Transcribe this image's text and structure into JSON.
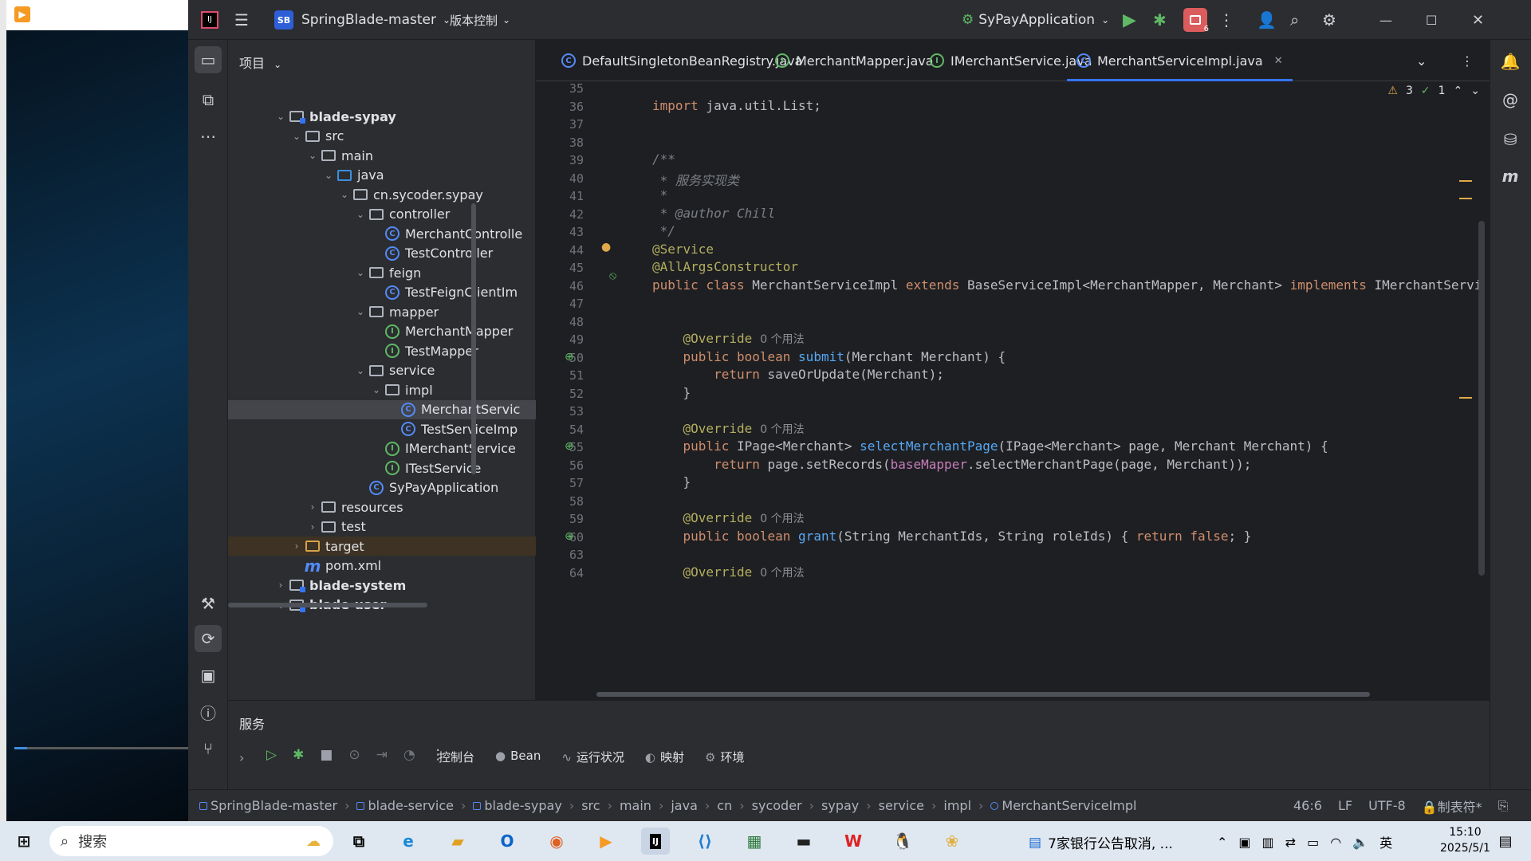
{
  "titlebar": {
    "project_badge": "SB",
    "project": "SpringBlade-master",
    "vcs": "版本控制",
    "run_config": "SyPayApplication",
    "notif_count": "6"
  },
  "project_panel": {
    "title": "项目"
  },
  "tree": [
    {
      "label": "blade-sypay",
      "icon": "module-folder-icon",
      "arrow": "⌄",
      "bold": true
    },
    {
      "label": "src",
      "icon": "folder-icon",
      "arrow": "⌄"
    },
    {
      "label": "main",
      "icon": "folder-icon",
      "arrow": "⌄"
    },
    {
      "label": "java",
      "icon": "source-folder-icon",
      "arrow": "⌄"
    },
    {
      "label": "cn.sycoder.sypay",
      "icon": "package-icon",
      "arrow": "⌄"
    },
    {
      "label": "controller",
      "icon": "package-icon",
      "arrow": "⌄"
    },
    {
      "label": "MerchantControlle",
      "icon": "class-icon",
      "arrow": ""
    },
    {
      "label": "TestController",
      "icon": "class-icon",
      "arrow": ""
    },
    {
      "label": "feign",
      "icon": "package-icon",
      "arrow": "⌄"
    },
    {
      "label": "TestFeignClientIm",
      "icon": "class-icon",
      "arrow": ""
    },
    {
      "label": "mapper",
      "icon": "package-icon",
      "arrow": "⌄"
    },
    {
      "label": "MerchantMapper",
      "icon": "interface-icon",
      "arrow": ""
    },
    {
      "label": "TestMapper",
      "icon": "interface-icon",
      "arrow": ""
    },
    {
      "label": "service",
      "icon": "package-icon",
      "arrow": "⌄"
    },
    {
      "label": "impl",
      "icon": "package-icon",
      "arrow": "⌄"
    },
    {
      "label": "MerchantServic",
      "icon": "class-icon",
      "arrow": "",
      "selected": true
    },
    {
      "label": "TestServiceImp",
      "icon": "class-icon",
      "arrow": ""
    },
    {
      "label": "IMerchantService",
      "icon": "interface-icon",
      "arrow": ""
    },
    {
      "label": "ITestService",
      "icon": "interface-icon",
      "arrow": ""
    },
    {
      "label": "SyPayApplication",
      "icon": "spring-app-icon",
      "arrow": ""
    },
    {
      "label": "resources",
      "icon": "folder-icon",
      "arrow": "›"
    },
    {
      "label": "test",
      "icon": "folder-icon",
      "arrow": "›"
    },
    {
      "label": "target",
      "icon": "target-folder-icon",
      "arrow": "›",
      "excluded": true
    },
    {
      "label": "pom.xml",
      "icon": "maven-icon",
      "arrow": ""
    },
    {
      "label": "blade-system",
      "icon": "module-folder-icon",
      "arrow": "›",
      "bold": true
    },
    {
      "label": "blade-user",
      "icon": "module-folder-icon",
      "arrow": "⌄",
      "bold": true
    }
  ],
  "tabs": [
    {
      "label": "DefaultSingletonBeanRegistry.java",
      "type": "class"
    },
    {
      "label": "MerchantMapper.java",
      "type": "interface"
    },
    {
      "label": "IMerchantService.java",
      "type": "interface"
    },
    {
      "label": "MerchantServiceImpl.java",
      "type": "class",
      "active": true
    }
  ],
  "inspections": {
    "warnings": "3",
    "ok": "1"
  },
  "code": [
    {
      "n": "35",
      "parts": []
    },
    {
      "n": "36",
      "parts": [
        {
          "t": "import",
          "c": "kw"
        },
        {
          "t": " java.util.List;"
        }
      ]
    },
    {
      "n": "37",
      "parts": []
    },
    {
      "n": "38",
      "parts": []
    },
    {
      "n": "39",
      "parts": [
        {
          "t": "/**",
          "c": "cm"
        }
      ]
    },
    {
      "n": "40",
      "parts": [
        {
          "t": " * 服务实现类",
          "c": "cm"
        }
      ]
    },
    {
      "n": "41",
      "parts": [
        {
          "t": " *",
          "c": "cm"
        }
      ]
    },
    {
      "n": "42",
      "parts": [
        {
          "t": " * @author Chill",
          "c": "cm"
        }
      ]
    },
    {
      "n": "43",
      "parts": [
        {
          "t": " */",
          "c": "cm"
        }
      ]
    },
    {
      "n": "44",
      "parts": [
        {
          "t": "@Service",
          "c": "an"
        }
      ]
    },
    {
      "n": "45",
      "parts": [
        {
          "t": "@AllArgsConstructor",
          "c": "an"
        }
      ]
    },
    {
      "n": "46",
      "parts": [
        {
          "t": "public",
          "c": "kw"
        },
        {
          "t": " "
        },
        {
          "t": "class",
          "c": "kw"
        },
        {
          "t": " MerchantServiceImpl "
        },
        {
          "t": "extends",
          "c": "kw"
        },
        {
          "t": " BaseServiceImpl<MerchantMapper, Merchant> "
        },
        {
          "t": "implements",
          "c": "kw"
        },
        {
          "t": " IMerchantServi"
        }
      ]
    },
    {
      "n": "47",
      "parts": []
    },
    {
      "n": "48",
      "parts": []
    },
    {
      "n": "49",
      "parts": [
        {
          "t": "    @Override",
          "c": "an"
        },
        {
          "t": "0 个用法",
          "c": "hint"
        }
      ]
    },
    {
      "n": "50",
      "parts": [
        {
          "t": "    public",
          "c": "kw"
        },
        {
          "t": " "
        },
        {
          "t": "boolean",
          "c": "kw"
        },
        {
          "t": " "
        },
        {
          "t": "submit",
          "c": "fn"
        },
        {
          "t": "(Merchant Merchant) {"
        }
      ]
    },
    {
      "n": "51",
      "parts": [
        {
          "t": "        return",
          "c": "kw"
        },
        {
          "t": " saveOrUpdate(Merchant);"
        }
      ]
    },
    {
      "n": "52",
      "parts": [
        {
          "t": "    }"
        }
      ]
    },
    {
      "n": "53",
      "parts": []
    },
    {
      "n": "54",
      "parts": [
        {
          "t": "    @Override",
          "c": "an"
        },
        {
          "t": "0 个用法",
          "c": "hint"
        }
      ]
    },
    {
      "n": "55",
      "parts": [
        {
          "t": "    public",
          "c": "kw"
        },
        {
          "t": " IPage<Merchant> "
        },
        {
          "t": "selectMerchantPage",
          "c": "fn"
        },
        {
          "t": "(IPage<Merchant> page, Merchant Merchant) {"
        }
      ]
    },
    {
      "n": "56",
      "parts": [
        {
          "t": "        return",
          "c": "kw"
        },
        {
          "t": " page.setRecords("
        },
        {
          "t": "baseMapper",
          "c": "fd"
        },
        {
          "t": ".selectMerchantPage(page, Merchant));"
        }
      ]
    },
    {
      "n": "57",
      "parts": [
        {
          "t": "    }"
        }
      ]
    },
    {
      "n": "58",
      "parts": []
    },
    {
      "n": "59",
      "parts": [
        {
          "t": "    @Override",
          "c": "an"
        },
        {
          "t": "0 个用法",
          "c": "hint"
        }
      ]
    },
    {
      "n": "60",
      "parts": [
        {
          "t": "    public",
          "c": "kw"
        },
        {
          "t": " "
        },
        {
          "t": "boolean",
          "c": "kw"
        },
        {
          "t": " "
        },
        {
          "t": "grant",
          "c": "fn"
        },
        {
          "t": "(String MerchantIds, String roleIds) { "
        },
        {
          "t": "return",
          "c": "kw"
        },
        {
          "t": " "
        },
        {
          "t": "false",
          "c": "kw"
        },
        {
          "t": "; }"
        }
      ]
    },
    {
      "n": "63",
      "parts": []
    },
    {
      "n": "64",
      "parts": [
        {
          "t": "    @Override",
          "c": "an"
        },
        {
          "t": "0 个用法",
          "c": "hint"
        }
      ]
    }
  ],
  "services": {
    "title": "服务",
    "tabs": [
      "控制台",
      "Bean",
      "运行状况",
      "映射",
      "环境"
    ]
  },
  "breadcrumb": [
    "SpringBlade-master",
    "blade-service",
    "blade-sypay",
    "src",
    "main",
    "java",
    "cn",
    "sycoder",
    "sypay",
    "service",
    "impl",
    "MerchantServiceImpl"
  ],
  "status": {
    "position": "46:6",
    "line_sep": "LF",
    "encoding": "UTF-8",
    "indent": "制表符*"
  },
  "taskbar": {
    "search": "搜索",
    "news": "7家银行公告取消, ...",
    "ime": "英",
    "time": "15:10",
    "date": "2025/5/1"
  }
}
